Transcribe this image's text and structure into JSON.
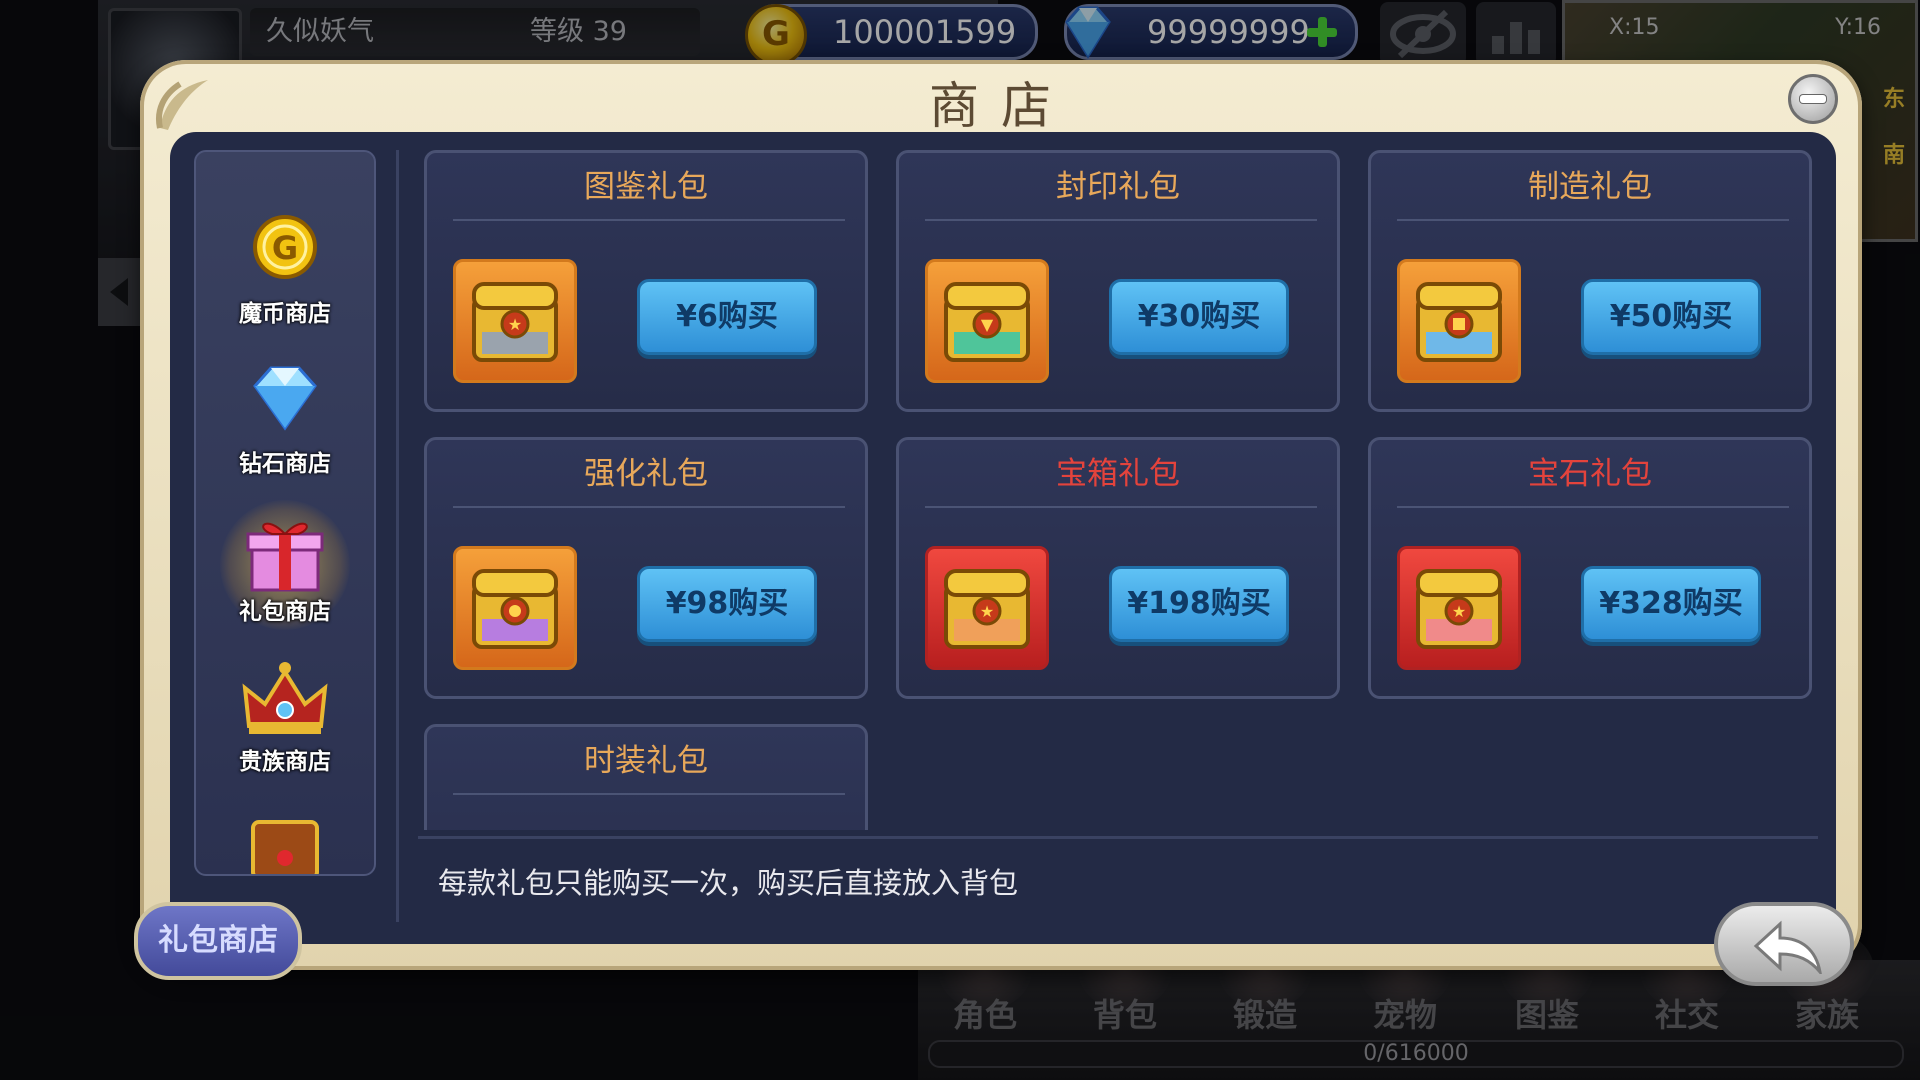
{
  "player": {
    "name": "久似妖气",
    "level_label": "等级",
    "level": "39"
  },
  "currency": {
    "gold": "100001599",
    "gold_icon_glyph": "G",
    "diamond": "99999999"
  },
  "minimap": {
    "x": "X:15",
    "y": "Y:16",
    "dir_east": "东",
    "dir_south": "南"
  },
  "shop": {
    "title": "商店",
    "categories": [
      {
        "label": "魔币商店",
        "icon": "gold-coin-icon"
      },
      {
        "label": "钻石商店",
        "icon": "diamond-icon"
      },
      {
        "label": "礼包商店",
        "icon": "gift-box-icon",
        "active": true
      },
      {
        "label": "贵族商店",
        "icon": "crown-icon"
      },
      {
        "label": "",
        "icon": "treasure-chest-icon"
      }
    ],
    "packs": [
      {
        "name": "图鉴礼包",
        "price_label": "¥6购买",
        "frame": "orange"
      },
      {
        "name": "封印礼包",
        "price_label": "¥30购买",
        "frame": "orange"
      },
      {
        "name": "制造礼包",
        "price_label": "¥50购买",
        "frame": "orange"
      },
      {
        "name": "强化礼包",
        "price_label": "¥98购买",
        "frame": "orange"
      },
      {
        "name": "宝箱礼包",
        "price_label": "¥198购买",
        "frame": "red"
      },
      {
        "name": "宝石礼包",
        "price_label": "¥328购买",
        "frame": "red"
      },
      {
        "name": "时装礼包",
        "price_label": "",
        "frame": "orange"
      }
    ],
    "notice": "每款礼包只能购买一次，购买后直接放入背包",
    "current_tab": "礼包商店"
  },
  "bottom_nav": [
    "角色",
    "背包",
    "锻造",
    "宠物",
    "图鉴",
    "社交",
    "家族"
  ],
  "exp": "0/616000",
  "colors": {
    "gold_name": "#e8a85a",
    "red_name": "#e4433c",
    "button_blue": "#3d9ee2",
    "panel_navy": "#232a45"
  }
}
